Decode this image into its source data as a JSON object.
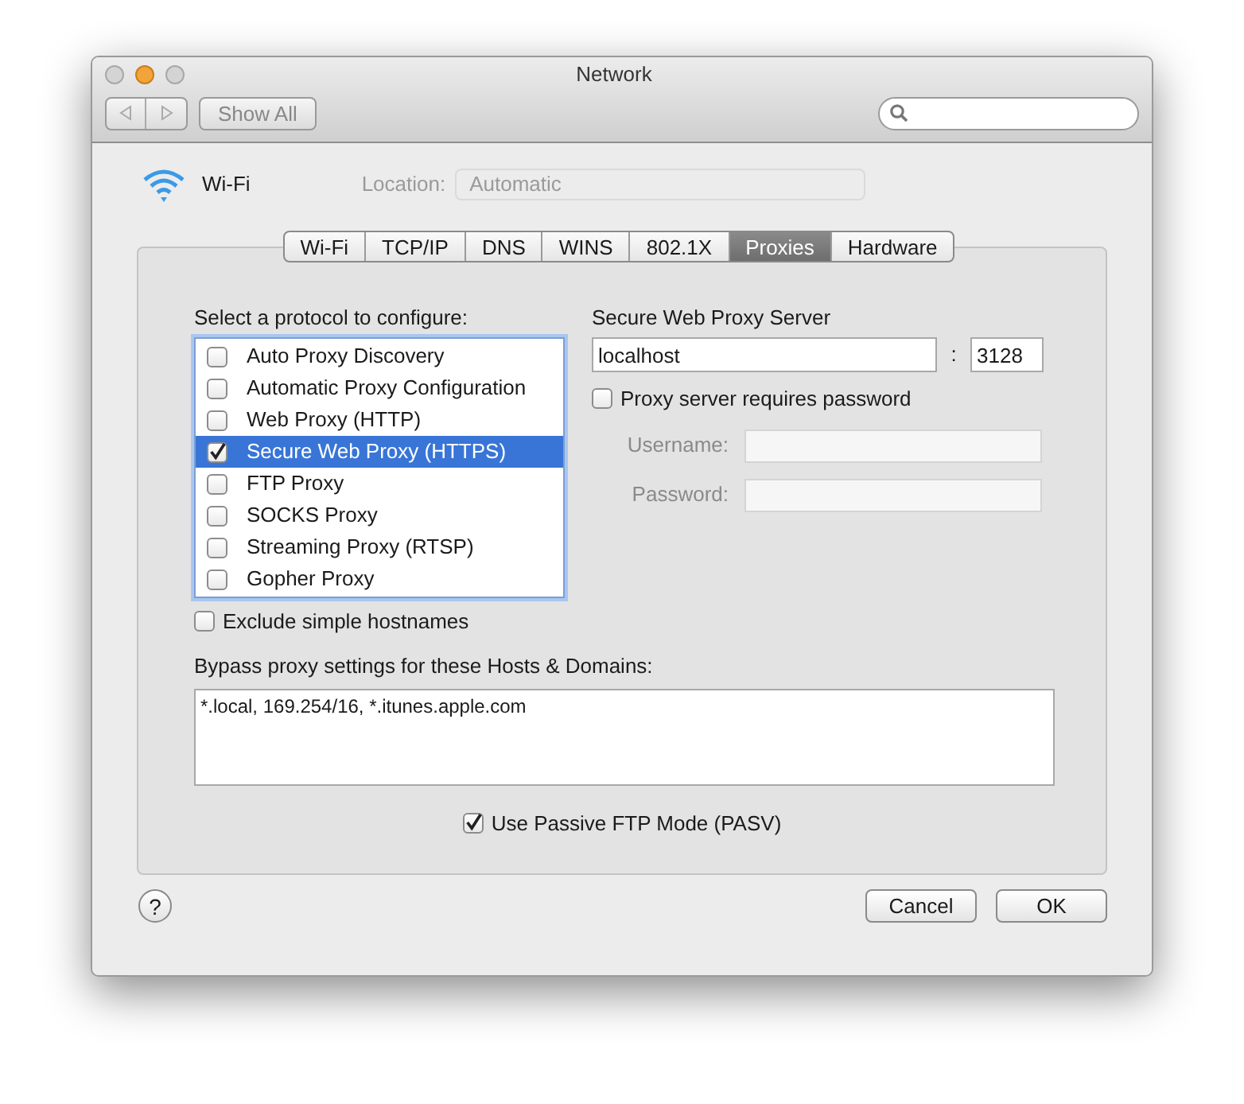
{
  "window": {
    "title": "Network"
  },
  "toolbar": {
    "show_all": "Show All"
  },
  "header": {
    "interface": "Wi-Fi",
    "location_label": "Location:",
    "location_value": "Automatic"
  },
  "tabs": [
    {
      "label": "Wi-Fi",
      "selected": false
    },
    {
      "label": "TCP/IP",
      "selected": false
    },
    {
      "label": "DNS",
      "selected": false
    },
    {
      "label": "WINS",
      "selected": false
    },
    {
      "label": "802.1X",
      "selected": false
    },
    {
      "label": "Proxies",
      "selected": true
    },
    {
      "label": "Hardware",
      "selected": false
    }
  ],
  "protocols": {
    "label": "Select a protocol to configure:",
    "items": [
      {
        "label": "Auto Proxy Discovery",
        "checked": false,
        "selected": false
      },
      {
        "label": "Automatic Proxy Configuration",
        "checked": false,
        "selected": false
      },
      {
        "label": "Web Proxy (HTTP)",
        "checked": false,
        "selected": false
      },
      {
        "label": "Secure Web Proxy (HTTPS)",
        "checked": true,
        "selected": true
      },
      {
        "label": "FTP Proxy",
        "checked": false,
        "selected": false
      },
      {
        "label": "SOCKS Proxy",
        "checked": false,
        "selected": false
      },
      {
        "label": "Streaming Proxy (RTSP)",
        "checked": false,
        "selected": false
      },
      {
        "label": "Gopher Proxy",
        "checked": false,
        "selected": false
      }
    ]
  },
  "server": {
    "title": "Secure Web Proxy Server",
    "host": "localhost",
    "separator": ":",
    "port": "3128",
    "requires_password": {
      "label": "Proxy server requires password",
      "checked": false
    },
    "username": {
      "label": "Username:",
      "disabled": true
    },
    "password": {
      "label": "Password:",
      "disabled": true
    }
  },
  "exclude_simple_hostnames": {
    "label": "Exclude simple hostnames",
    "checked": false
  },
  "bypass": {
    "label": "Bypass proxy settings for these Hosts & Domains:",
    "value": "*.local, 169.254/16, *.itunes.apple.com"
  },
  "passive_ftp": {
    "label": "Use Passive FTP Mode (PASV)",
    "checked": true
  },
  "help": "?",
  "buttons": [
    {
      "label": "Cancel",
      "kind": "normal"
    },
    {
      "label": "OK",
      "kind": "normal"
    }
  ]
}
